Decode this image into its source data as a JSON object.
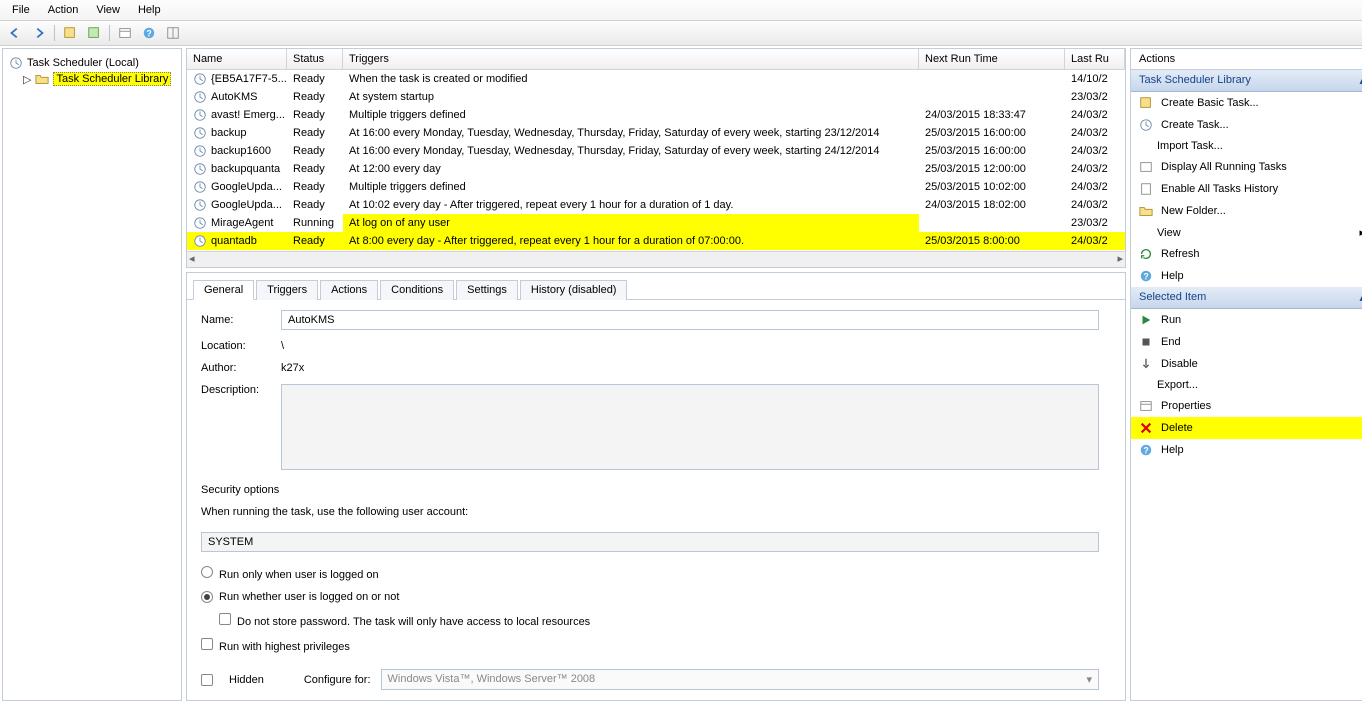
{
  "menu": {
    "file": "File",
    "action": "Action",
    "view": "View",
    "help": "Help"
  },
  "tree": {
    "root": "Task Scheduler (Local)",
    "library": "Task Scheduler Library"
  },
  "columns": {
    "name": "Name",
    "status": "Status",
    "triggers": "Triggers",
    "next": "Next Run Time",
    "last": "Last Ru"
  },
  "tasks": [
    {
      "name": "{EB5A17F7-5...",
      "status": "Ready",
      "trigger": "When the task is created or modified",
      "next": "",
      "last": "14/10/2"
    },
    {
      "name": "AutoKMS",
      "status": "Ready",
      "trigger": "At system startup",
      "next": "",
      "last": "23/03/2"
    },
    {
      "name": "avast! Emerg...",
      "status": "Ready",
      "trigger": "Multiple triggers defined",
      "next": "24/03/2015 18:33:47",
      "last": "24/03/2"
    },
    {
      "name": "backup",
      "status": "Ready",
      "trigger": "At 16:00 every Monday, Tuesday, Wednesday, Thursday, Friday, Saturday of every week, starting 23/12/2014",
      "next": "25/03/2015 16:00:00",
      "last": "24/03/2"
    },
    {
      "name": "backup1600",
      "status": "Ready",
      "trigger": "At 16:00 every Monday, Tuesday, Wednesday, Thursday, Friday, Saturday of every week, starting 24/12/2014",
      "next": "25/03/2015 16:00:00",
      "last": "24/03/2"
    },
    {
      "name": "backupquanta",
      "status": "Ready",
      "trigger": "At 12:00 every day",
      "next": "25/03/2015 12:00:00",
      "last": "24/03/2"
    },
    {
      "name": "GoogleUpda...",
      "status": "Ready",
      "trigger": "Multiple triggers defined",
      "next": "25/03/2015 10:02:00",
      "last": "24/03/2"
    },
    {
      "name": "GoogleUpda...",
      "status": "Ready",
      "trigger": "At 10:02 every day - After triggered, repeat every 1 hour for a duration of 1 day.",
      "next": "24/03/2015 18:02:00",
      "last": "24/03/2"
    },
    {
      "name": "MirageAgent",
      "status": "Running",
      "trigger": "At log on of any user",
      "next": "",
      "last": "23/03/2",
      "yt": true
    },
    {
      "name": "quantadb",
      "status": "Ready",
      "trigger": "At 8:00 every day - After triggered, repeat every 1 hour for a duration of 07:00:00.",
      "next": "25/03/2015 8:00:00",
      "last": "24/03/2",
      "y": true
    }
  ],
  "tabs": {
    "general": "General",
    "triggers": "Triggers",
    "actions": "Actions",
    "conditions": "Conditions",
    "settings": "Settings",
    "history": "History (disabled)"
  },
  "details": {
    "name_l": "Name:",
    "name_v": "AutoKMS",
    "loc_l": "Location:",
    "loc_v": "\\",
    "auth_l": "Author:",
    "auth_v": "k27x",
    "desc_l": "Description:",
    "sec_title": "Security options",
    "sec_sub": "When running the task, use the following user account:",
    "account": "SYSTEM",
    "r1": "Run only when user is logged on",
    "r2": "Run whether user is logged on or not",
    "c1": "Do not store password.  The task will only have access to local resources",
    "c2": "Run with highest privileges",
    "hidden": "Hidden",
    "cfg_l": "Configure for:",
    "cfg_v": "Windows Vista™, Windows Server™ 2008"
  },
  "actions_panel": {
    "title": "Actions",
    "lib": "Task Scheduler Library",
    "create_basic": "Create Basic Task...",
    "create": "Create Task...",
    "import": "Import Task...",
    "display_running": "Display All Running Tasks",
    "enable_history": "Enable All Tasks History",
    "new_folder": "New Folder...",
    "view": "View",
    "refresh": "Refresh",
    "help": "Help",
    "selected": "Selected Item",
    "run": "Run",
    "end": "End",
    "disable": "Disable",
    "export": "Export...",
    "properties": "Properties",
    "delete": "Delete",
    "help2": "Help"
  }
}
